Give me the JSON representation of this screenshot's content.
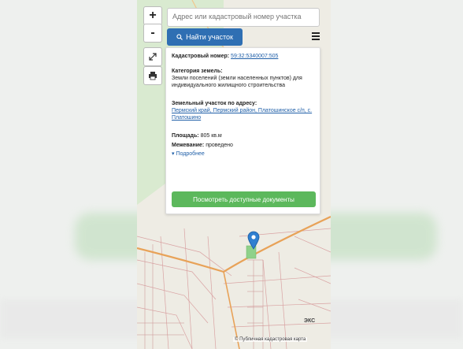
{
  "search": {
    "placeholder": "Адрес или кадастровый номер участка"
  },
  "controls": {
    "zoom_in": "+",
    "zoom_out": "-"
  },
  "find_button": {
    "label": "Найти участок",
    "icon": "search-icon"
  },
  "card": {
    "cadastral_label": "Кадастровый номер:",
    "cadastral_value": "59:32:5340007:505",
    "category_label": "Категория земель:",
    "category_value": "Земли поселений (земли населенных пунктов) для индивидуального жилищного строительства",
    "address_label": "Земельный участок по адресу:",
    "address_value": "Пермский край, Пермский район, Платошинское с/п, с. Платошино",
    "area_label": "Площадь:",
    "area_value": "805 кв.м",
    "survey_label": "Межевание:",
    "survey_value": "проведено",
    "more": "▾ Подробнее",
    "docs_button": "Посмотреть доступные документы"
  },
  "map": {
    "logo": "ЭКС",
    "credit": "© Публичная кадастровая карта"
  },
  "colors": {
    "find_button": "#2f6fb3",
    "docs_button": "#5cb85c",
    "pin": "#2f7fd0"
  }
}
